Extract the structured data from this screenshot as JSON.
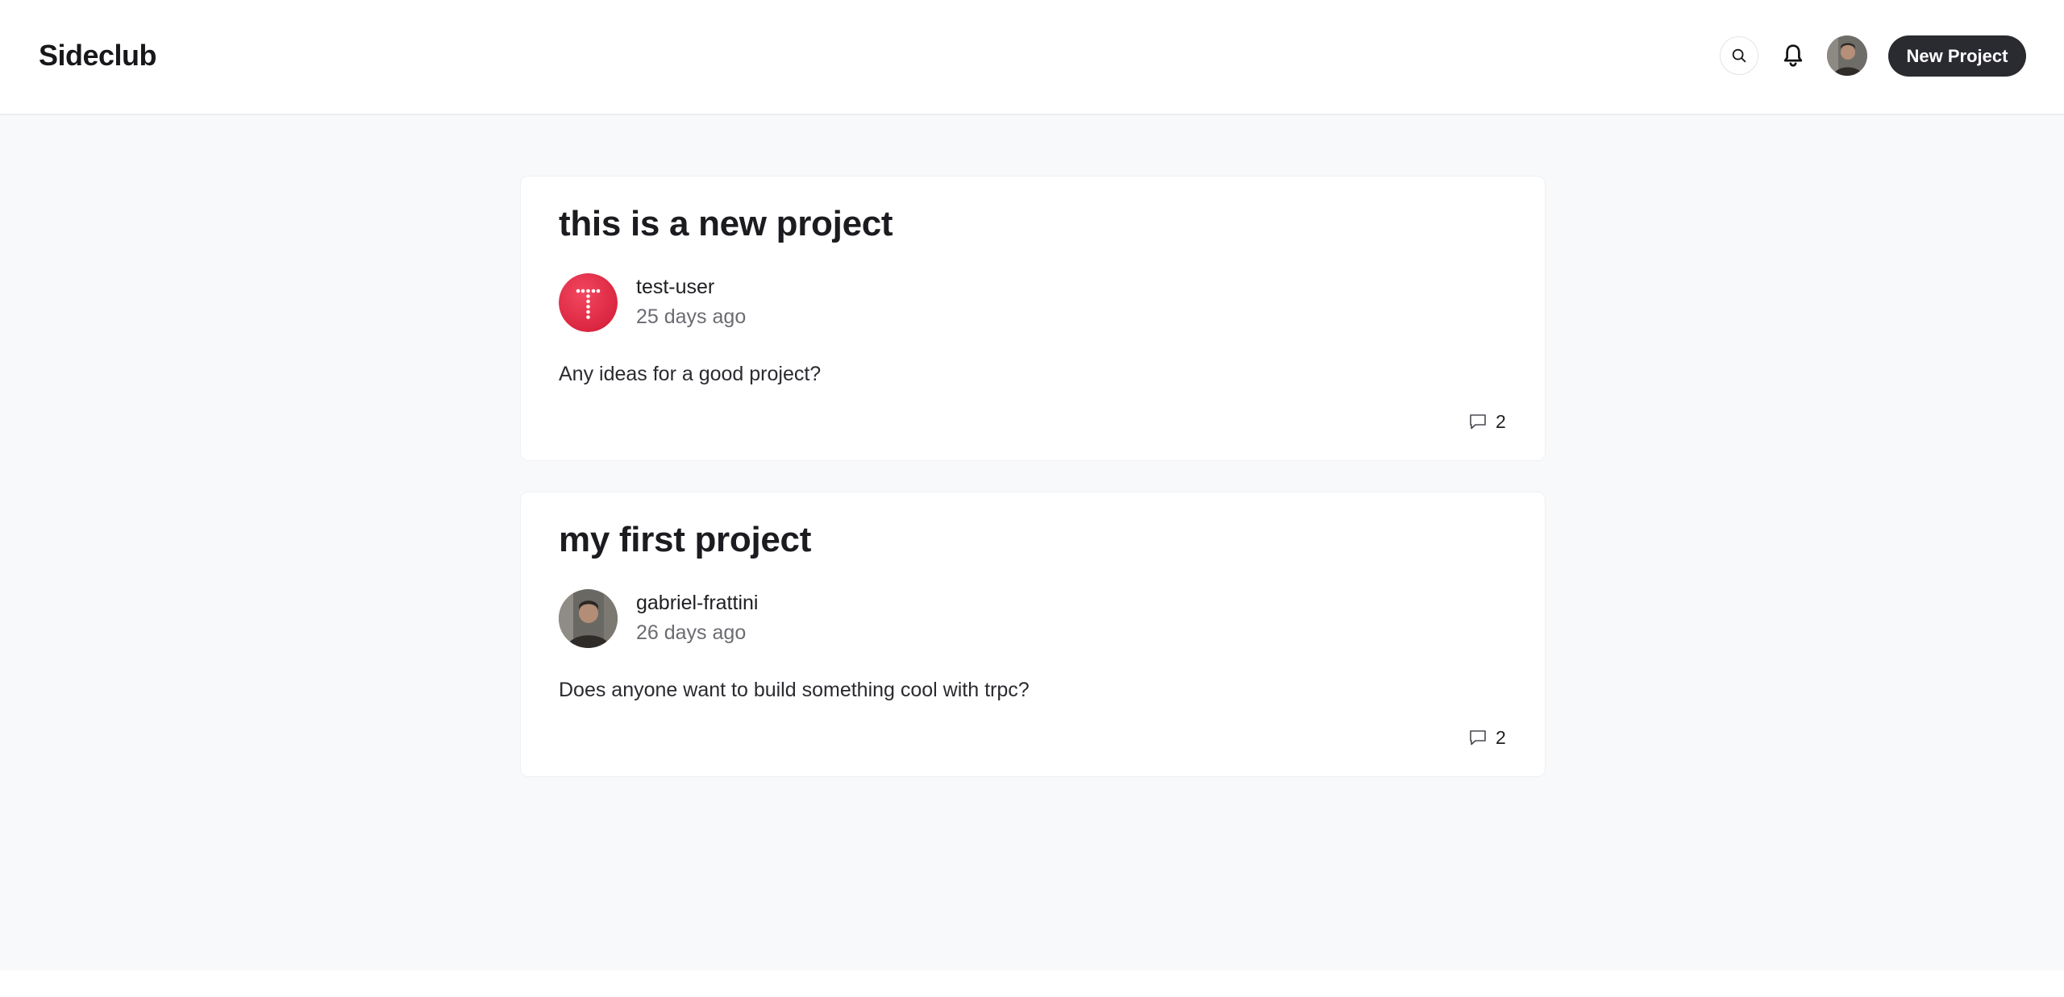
{
  "header": {
    "brand": "Sideclub",
    "new_project_label": "New Project",
    "icons": {
      "search": "search-icon",
      "notifications": "bell-icon"
    }
  },
  "projects": [
    {
      "title": "this is a new project",
      "author": "test-user",
      "time_ago": "25 days ago",
      "body": "Any ideas for a good project?",
      "comments": "2",
      "avatar_color": "#e8324b"
    },
    {
      "title": "my first project",
      "author": "gabriel-frattini",
      "time_ago": "26 days ago",
      "body": "Does anyone want to build something cool with trpc?",
      "comments": "2",
      "avatar_color": "#5c5a55"
    }
  ],
  "colors": {
    "accent_button": "#2a2a31",
    "page_background": "#f8f9fa"
  }
}
